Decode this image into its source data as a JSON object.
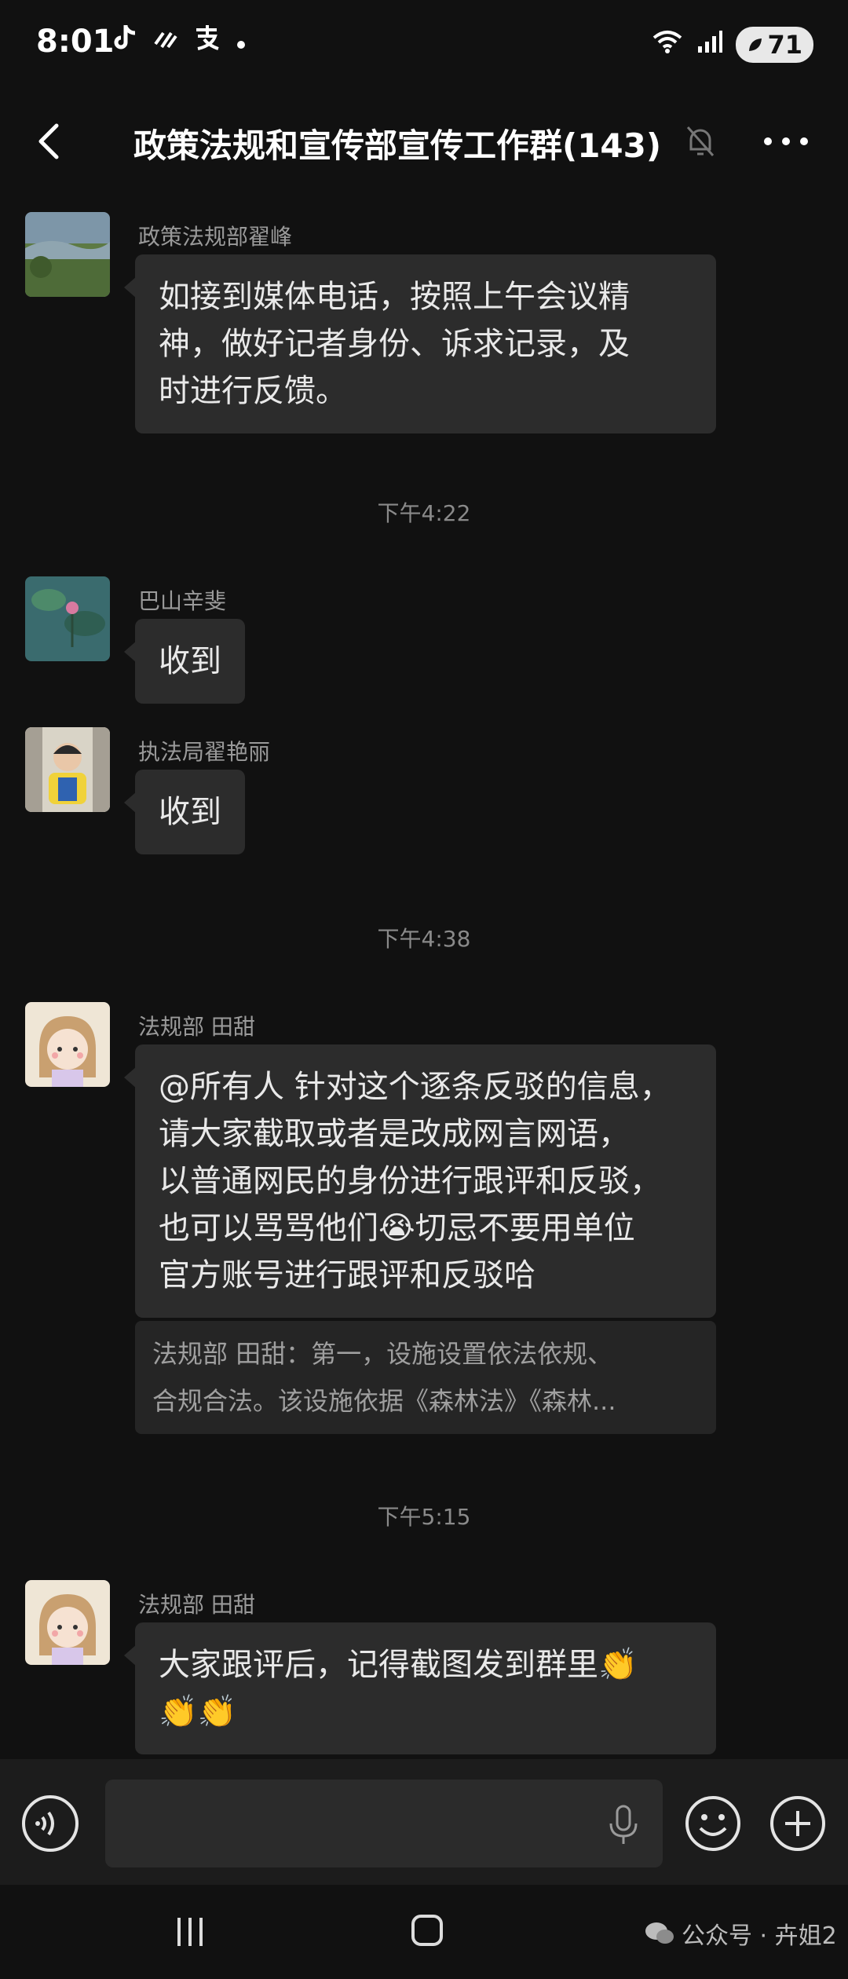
{
  "status_bar": {
    "time": "8:01",
    "battery": "71",
    "app_icons": [
      "tiktok-icon",
      "signal-dashes-icon",
      "alipay-icon",
      "dot-icon"
    ]
  },
  "nav": {
    "title": "政策法规和宣传部宣传工作群(143)"
  },
  "messages": [
    {
      "sender": "政策法规部翟峰",
      "lines": [
        "如接到媒体电话，按照上午会议精",
        "神，做好记者身份、诉求记录，及",
        "时进行反馈。"
      ]
    },
    {
      "time_separator": "下午4:22"
    },
    {
      "sender": "巴山辛斐",
      "lines": [
        "收到"
      ]
    },
    {
      "sender": "执法局翟艳丽",
      "lines": [
        "收到"
      ]
    },
    {
      "time_separator": "下午4:38"
    },
    {
      "sender": "法规部 田甜",
      "lines": [
        "@所有人  针对这个逐条反驳的信息，",
        "请大家截取或者是改成网言网语，",
        "以普通网民的身份进行跟评和反驳，",
        "也可以骂骂他们",
        "切忌不要用单位",
        "官方账号进行跟评和反驳哈"
      ],
      "emoji": "😭",
      "quote_lines": [
        "法规部 田甜：第一，设施设置依法依规、",
        "合规合法。该设施依据《森林法》《森林..."
      ]
    },
    {
      "time_separator": "下午5:15"
    },
    {
      "sender": "法规部 田甜",
      "lines": [
        "大家跟评后，记得截图发到群里"
      ],
      "emoji": "👏",
      "emoji_line2": "👏👏"
    }
  ],
  "input": {
    "placeholder": "",
    "value": ""
  },
  "watermark": {
    "text": "公众号 · 卉姐2"
  },
  "colors": {
    "background": "#111111",
    "bubble": "#2c2c2c",
    "sender_text": "#9a9a9a"
  }
}
